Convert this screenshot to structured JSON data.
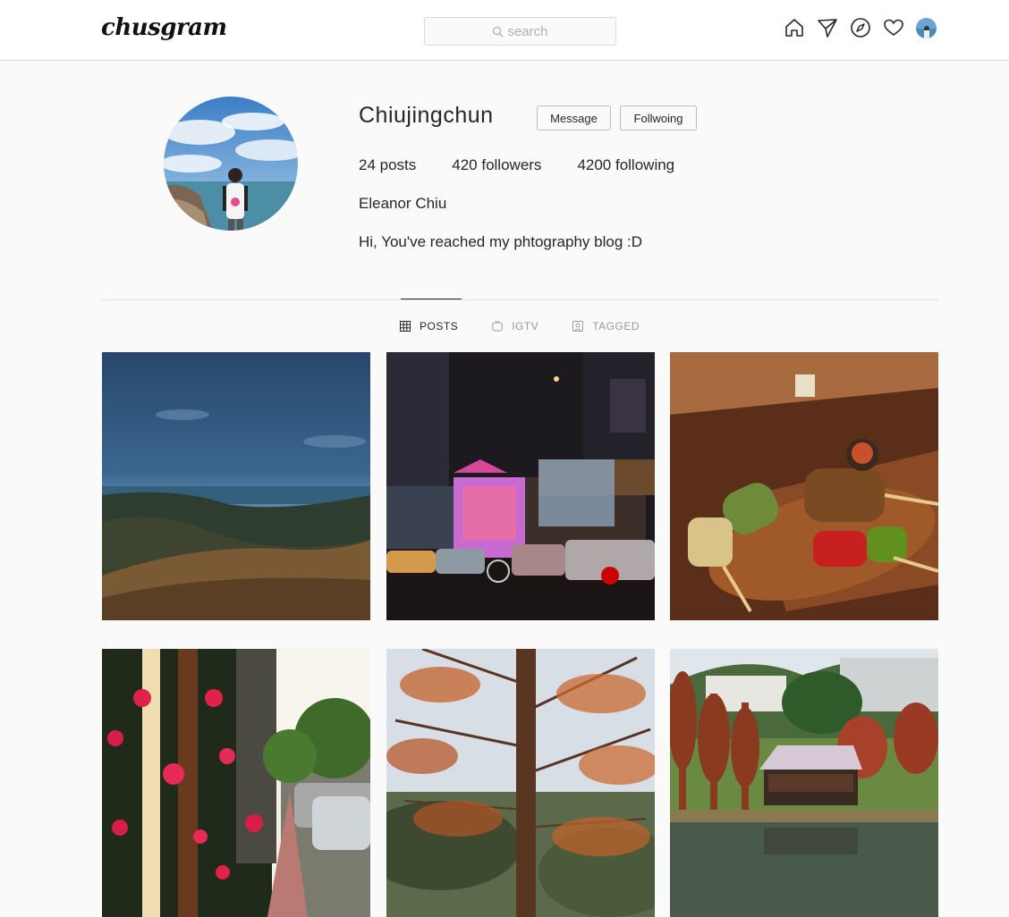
{
  "header": {
    "logo": "chusgram",
    "search_placeholder": "search",
    "icons": [
      "home-icon",
      "direct-icon",
      "explore-icon",
      "heart-icon"
    ]
  },
  "profile": {
    "username": "Chiujingchun",
    "message_button": "Message",
    "following_button": "Follwoing",
    "stats": {
      "posts": "24 posts",
      "followers": "420 followers",
      "following": "4200 following"
    },
    "full_name": "Eleanor Chiu",
    "bio": "Hi, You've reached my phtography blog :D"
  },
  "tabs": [
    {
      "label": "POSTS",
      "icon": "grid-icon",
      "active": true
    },
    {
      "label": "IGTV",
      "icon": "igtv-icon",
      "active": false
    },
    {
      "label": "TAGGED",
      "icon": "tagged-icon",
      "active": false
    }
  ],
  "posts": [
    {
      "subject": "mountain-sea-landscape"
    },
    {
      "subject": "night-street-gate"
    },
    {
      "subject": "grilled-skewers"
    },
    {
      "subject": "red-flowers-street"
    },
    {
      "subject": "autumn-tree"
    },
    {
      "subject": "lake-pavilion"
    }
  ],
  "colors": {
    "background": "#fafafa",
    "header_bg": "#ffffff",
    "border": "#dbdbdb",
    "text": "#262626",
    "muted": "#999999"
  }
}
